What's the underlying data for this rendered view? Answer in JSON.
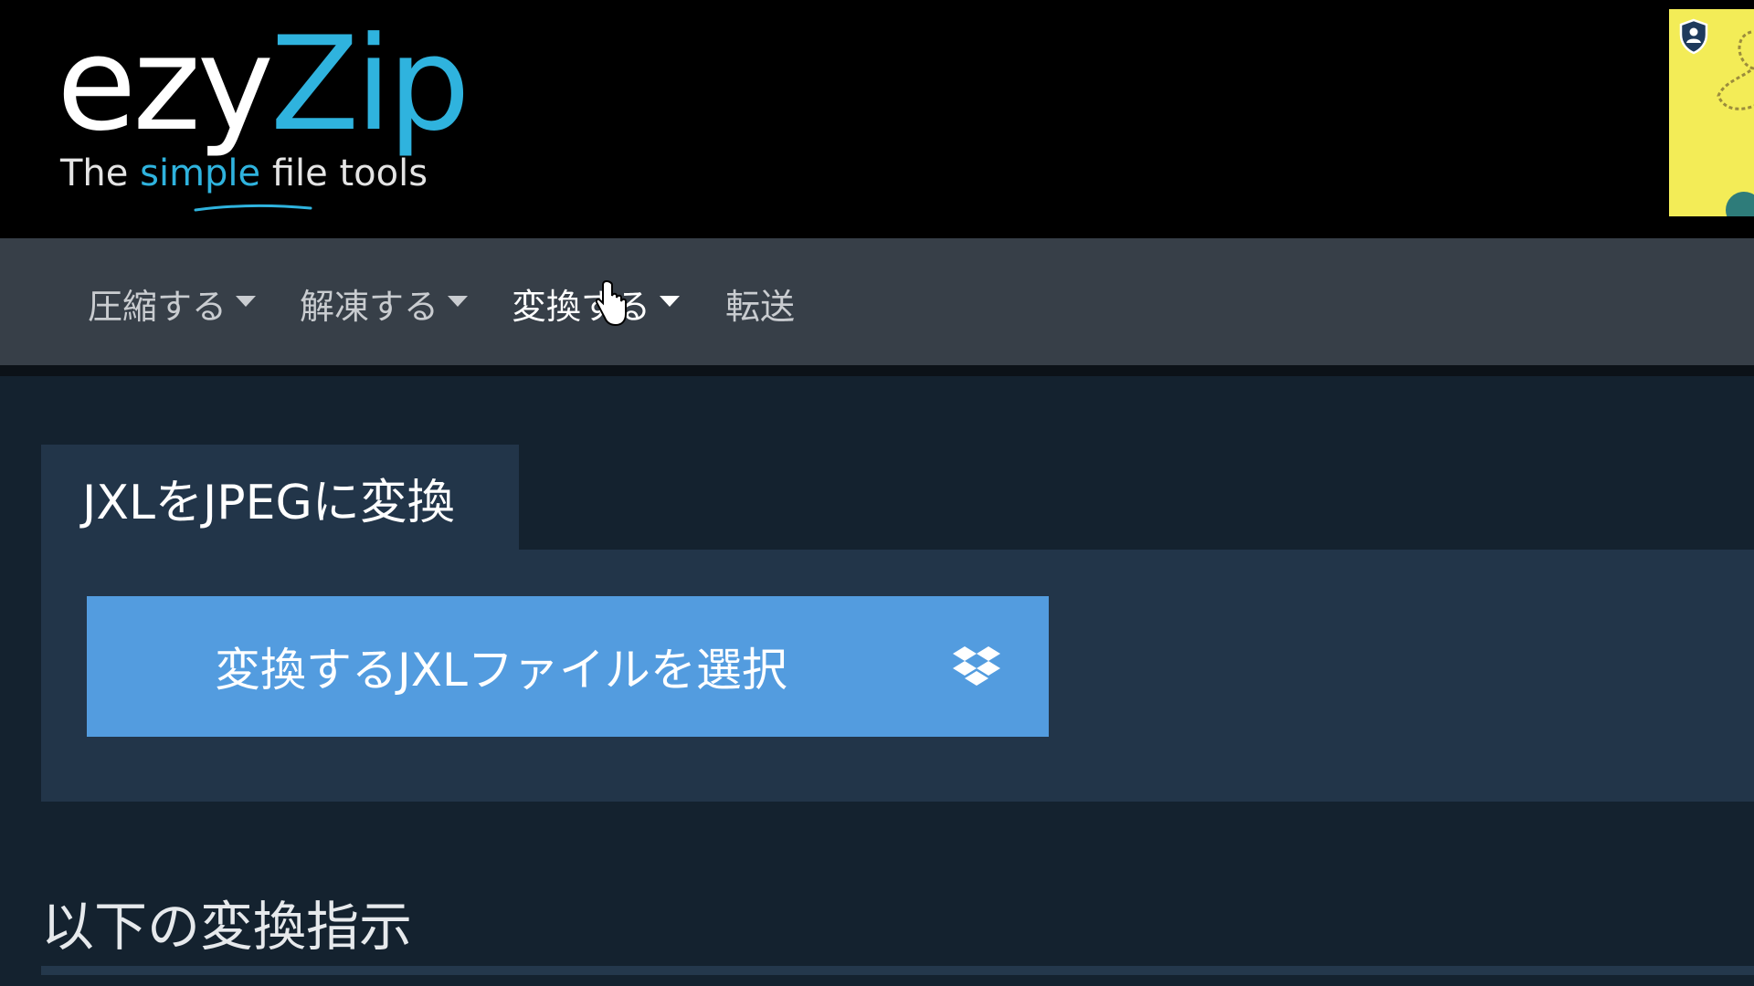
{
  "logo": {
    "brand_part1": "ezy",
    "brand_part2": "Zip",
    "tagline_before": "The ",
    "tagline_accent": "simple",
    "tagline_after": " file tools",
    "accent_color": "#2fb3de"
  },
  "nav": {
    "items": [
      {
        "label": "圧縮する",
        "has_dropdown": true
      },
      {
        "label": "解凍する",
        "has_dropdown": true
      },
      {
        "label": "変換する",
        "has_dropdown": true
      },
      {
        "label": "転送",
        "has_dropdown": false
      }
    ],
    "hovered_index": 2
  },
  "tool": {
    "tab_title": "JXLをJPEGに変換",
    "select_button_label": "変換するJXLファイルを選択",
    "select_button_icon": "dropbox-icon",
    "button_color": "#539cdf"
  },
  "instructions": {
    "heading": "以下の変換指示"
  },
  "colors": {
    "header_bg": "#000000",
    "nav_bg": "#373f48",
    "page_bg": "#14222f",
    "panel_bg": "#223549"
  }
}
